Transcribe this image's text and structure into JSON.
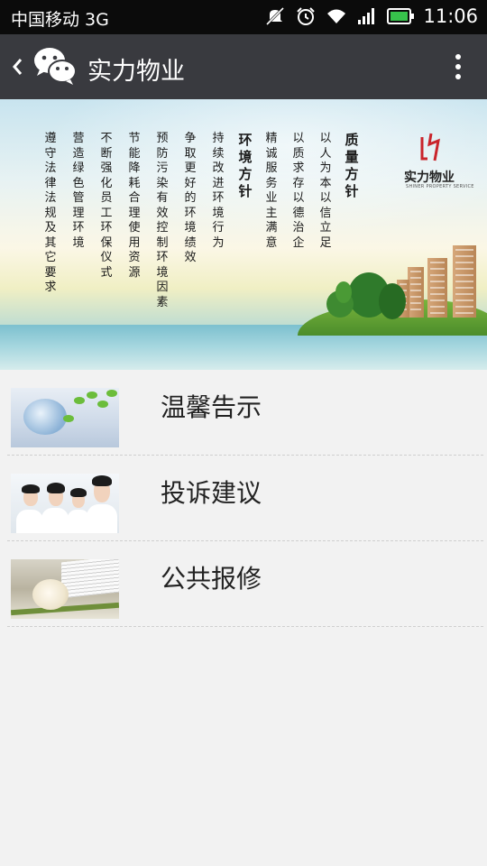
{
  "status_bar": {
    "carrier": "中国移动 3G",
    "time": "11:06",
    "icons": [
      "mute-icon",
      "alarm-icon",
      "wifi-icon",
      "signal-icon",
      "battery-icon"
    ]
  },
  "title_bar": {
    "title": "实力物业",
    "back_icon": "chevron-left-icon",
    "app_icon": "wechat-icon",
    "menu_icon": "more-vertical-icon"
  },
  "banner": {
    "heading": "质量方针",
    "heading2": "环境方针",
    "columns": [
      "以人为本 以信立足",
      "以质求存 以德治企",
      "精诚服务 业主满意",
      "持续改进环境行为",
      "争取更好的环境绩效",
      "预防污染有效控制环境因素",
      "节能降耗 合理使用资源",
      "不断强化员工环保仪式",
      "营造绿色管理环境",
      "遵守法律法规及其它要求"
    ],
    "logo_text": "实力物业",
    "logo_sub": "SHINER PROPERTY SERVICE"
  },
  "menu": {
    "items": [
      {
        "label": "温馨告示",
        "thumb": "notice-thumbnail"
      },
      {
        "label": "投诉建议",
        "thumb": "complaint-thumbnail"
      },
      {
        "label": "公共报修",
        "thumb": "repair-thumbnail"
      }
    ]
  },
  "colors": {
    "status_bg": "#0b0b0b",
    "titlebar_bg": "#393a3f",
    "page_bg": "#f2f2f2",
    "text": "#222222"
  }
}
